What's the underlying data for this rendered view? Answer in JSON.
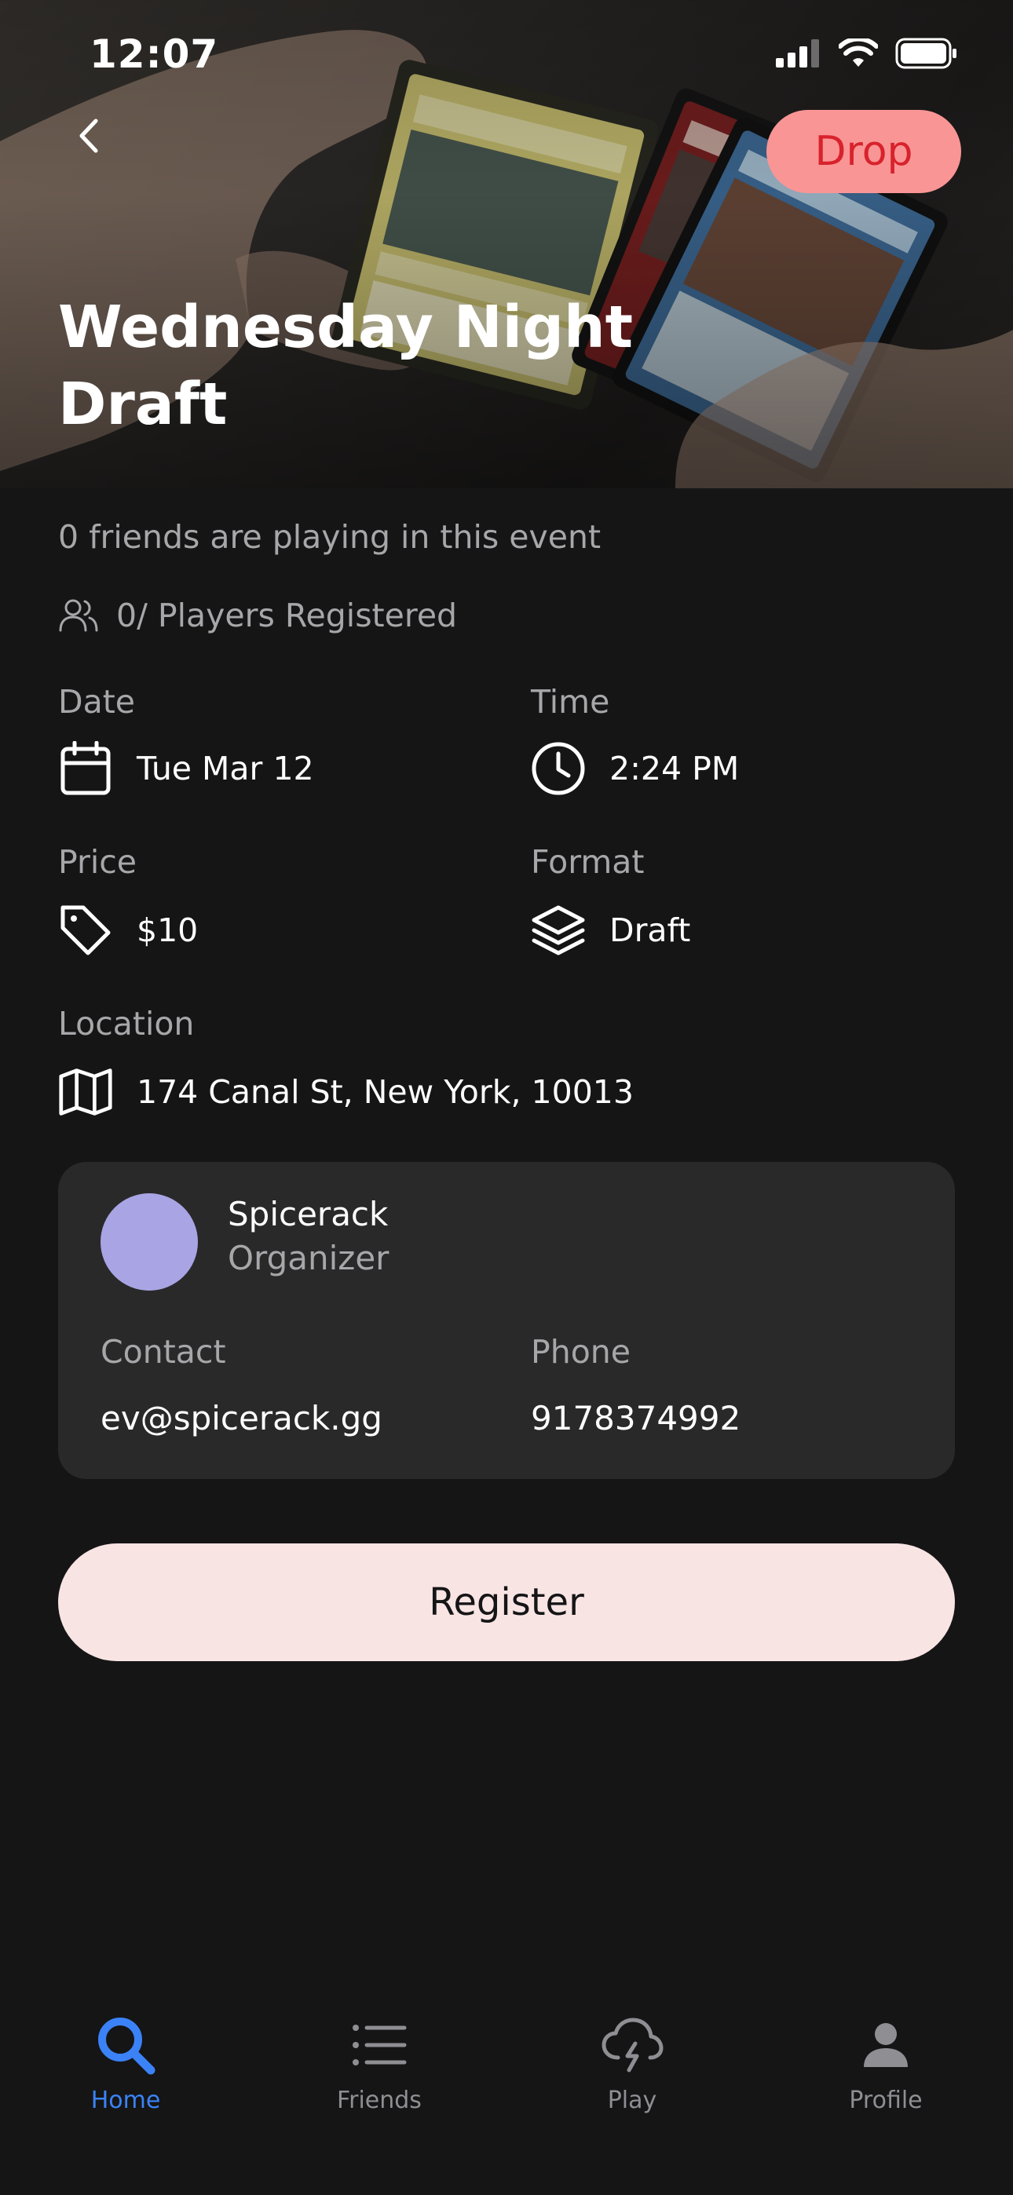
{
  "status_bar": {
    "time": "12:07"
  },
  "header": {
    "drop_label": "Drop",
    "title": "Wednesday Night Draft"
  },
  "event": {
    "friends_text": "0 friends are playing in this event",
    "players_text": "0/ Players Registered",
    "date_label": "Date",
    "date_value": "Tue Mar 12",
    "time_label": "Time",
    "time_value": "2:24 PM",
    "price_label": "Price",
    "price_value": "$10",
    "format_label": "Format",
    "format_value": "Draft",
    "location_label": "Location",
    "location_value": "174 Canal St, New York, 10013"
  },
  "organizer": {
    "name": "Spicerack",
    "role": "Organizer",
    "contact_label": "Contact",
    "contact_value": "ev@spicerack.gg",
    "phone_label": "Phone",
    "phone_value": "9178374992",
    "avatar_color": "#a9a5e4"
  },
  "register_label": "Register",
  "tabs": [
    {
      "label": "Home",
      "icon": "search-icon",
      "active": true
    },
    {
      "label": "Friends",
      "icon": "list-icon",
      "active": false
    },
    {
      "label": "Play",
      "icon": "storm-cloud-icon",
      "active": false
    },
    {
      "label": "Profile",
      "icon": "person-icon",
      "active": false
    }
  ],
  "colors": {
    "background": "#151516",
    "drop_bg": "#f99595",
    "drop_text": "#d8222c",
    "register_bg": "#f9e4e4",
    "accent_blue": "#3b82f6",
    "card_bg": "#29292a"
  }
}
